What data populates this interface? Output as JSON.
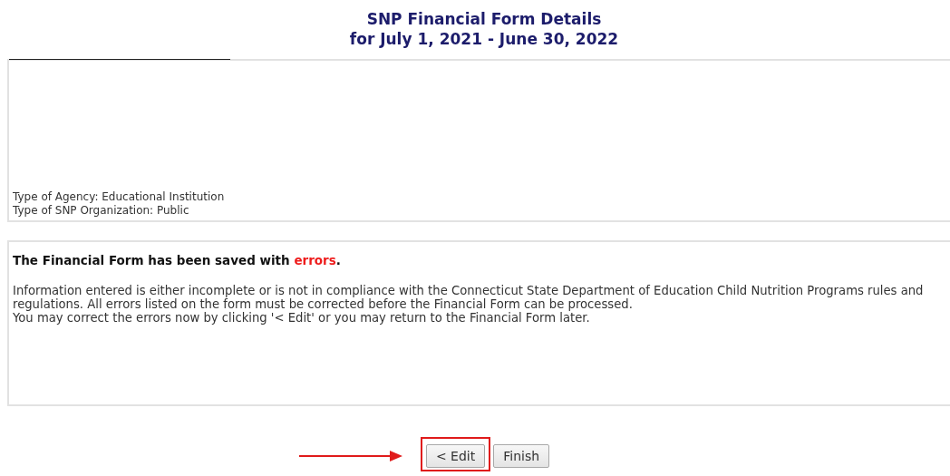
{
  "title": {
    "line_1": "SNP Financial Form Details",
    "line_2": "for July 1, 2021 - June 30, 2022"
  },
  "agency_info": [
    "Type of Agency: Educational Institution",
    "Type of SNP Organization: Public"
  ],
  "message": {
    "heading": {
      "text": "The Financial Form has been saved with ",
      "highlight": "errors",
      "end": "."
    },
    "paragraphs": [
      "Information entered is either incomplete or is not in compliance with the Connecticut State Department of Education Child Nutrition Programs rules and regulations. All errors listed on the form must be corrected before the Financial Form can be processed.",
      "You may correct the errors now by clicking '< Edit' or you may return to the Financial Form later."
    ]
  },
  "buttons": [
    {
      "label": "< Edit",
      "highlighted": true
    },
    {
      "label": "Finish",
      "highlighted": false
    }
  ]
}
